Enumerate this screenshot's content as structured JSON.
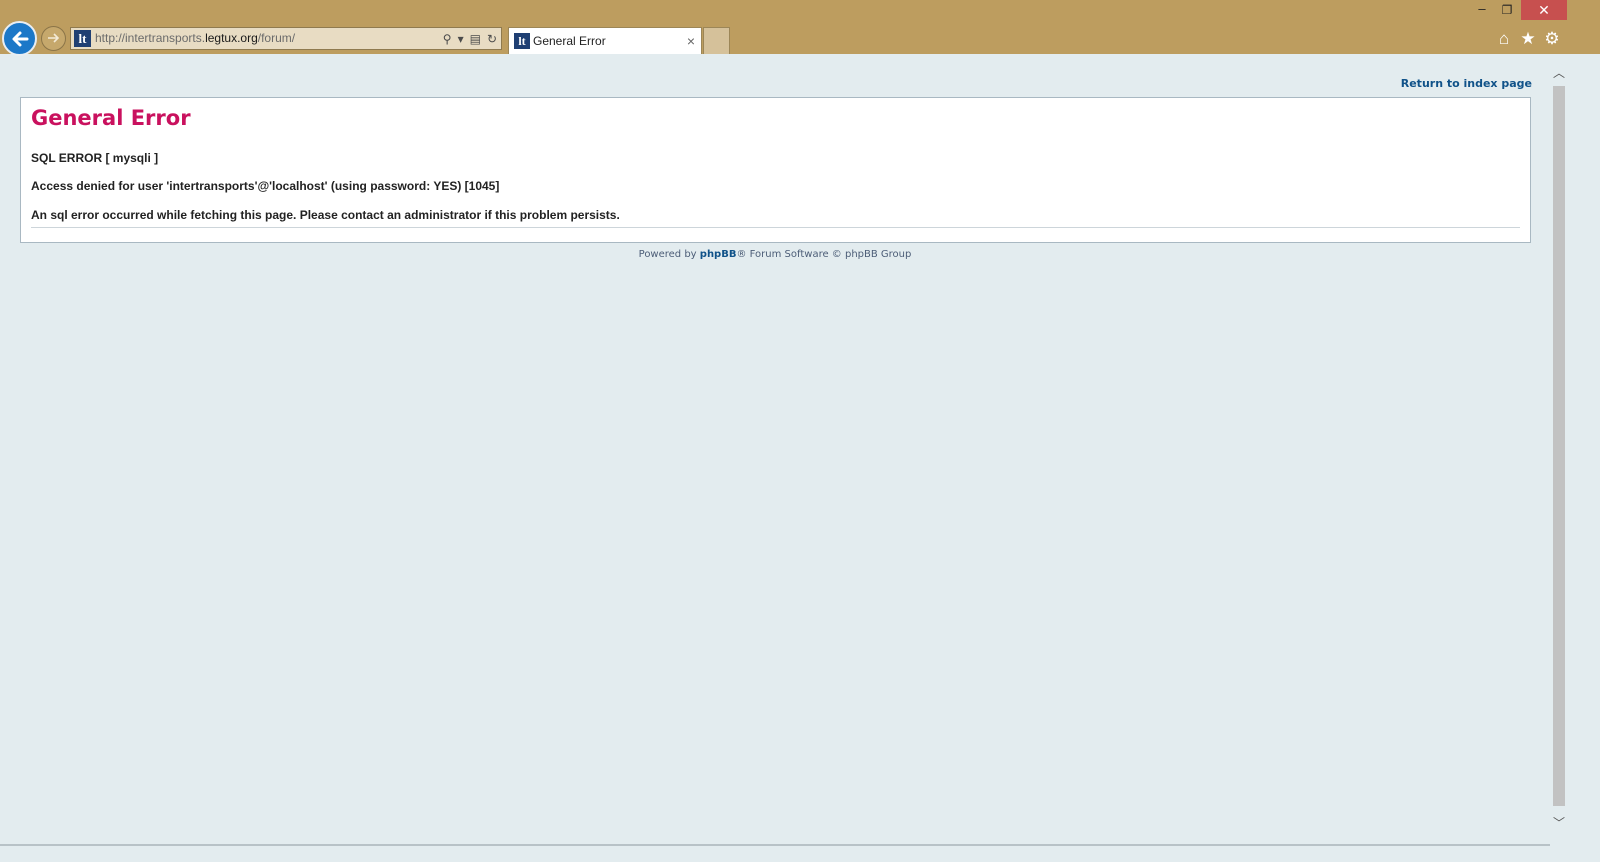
{
  "browser": {
    "url_prefix": "http://intertransports.",
    "url_domain": "legtux.org",
    "url_suffix": "/forum/",
    "favicon_text": "lt",
    "tab_title": "General Error",
    "tab_close": "×",
    "new_tab": "",
    "window": {
      "minimize": "–",
      "restore": "❐",
      "close": "✕"
    },
    "icons": [
      "back-icon",
      "forward-icon",
      "search-icon",
      "dropdown-icon",
      "compatibility-icon",
      "refresh-icon",
      "home-icon",
      "star-icon",
      "gear-icon"
    ]
  },
  "page": {
    "return_link": "Return to index page",
    "heading": "General Error",
    "messages": [
      "SQL ERROR [ mysqli ]",
      "Access denied for user 'intertransports'@'localhost' (using password: YES) [1045]",
      "An sql error occurred while fetching this page. Please contact an administrator if this problem persists."
    ],
    "footer_prefix": "Powered by ",
    "footer_brand": "phpBB",
    "footer_suffix": "® Forum Software © phpBB Group"
  },
  "colors": {
    "titlebar": "#bd9d5f",
    "heading": "#c9115e",
    "link": "#105289",
    "page_bg": "#e3ecef"
  }
}
